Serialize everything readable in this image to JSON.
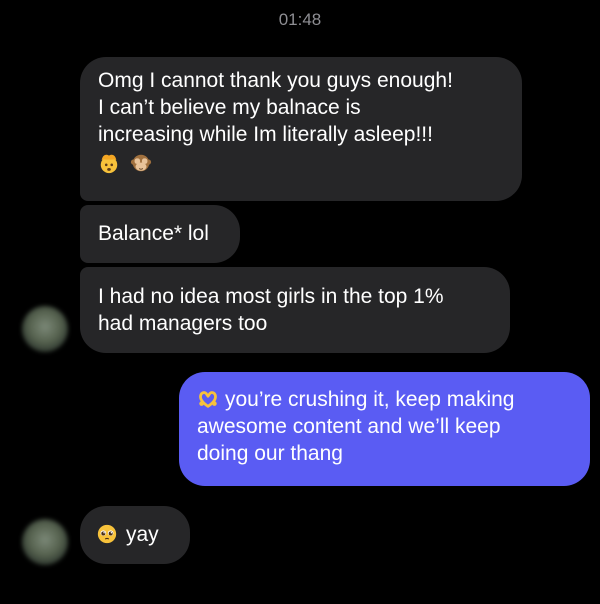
{
  "timestamp": "01:48",
  "messages": [
    {
      "lines": [
        "Omg I cannot thank you guys enough!",
        "I can’t believe my balnace is",
        "increasing while Im literally asleep!!!"
      ],
      "emojis": [
        "exploding-head-emoji",
        "see-no-evil-monkey-emoji"
      ]
    },
    {
      "text": "Balance* lol"
    },
    {
      "lines": [
        "I had no idea most girls in the top 1%",
        "had managers too"
      ]
    },
    {
      "lines": [
        "you’re crushing it, keep making",
        "awesome content and we’ll keep",
        "doing our thang"
      ],
      "emoji": "heart-hands-emoji"
    },
    {
      "text": "yay",
      "emoji": "pleading-face-emoji"
    }
  ],
  "colors": {
    "background": "#000000",
    "incoming_bubble": "#262628",
    "outgoing_bubble": "#5a5cf3",
    "timestamp": "#8e8e93",
    "text": "#ffffff"
  }
}
